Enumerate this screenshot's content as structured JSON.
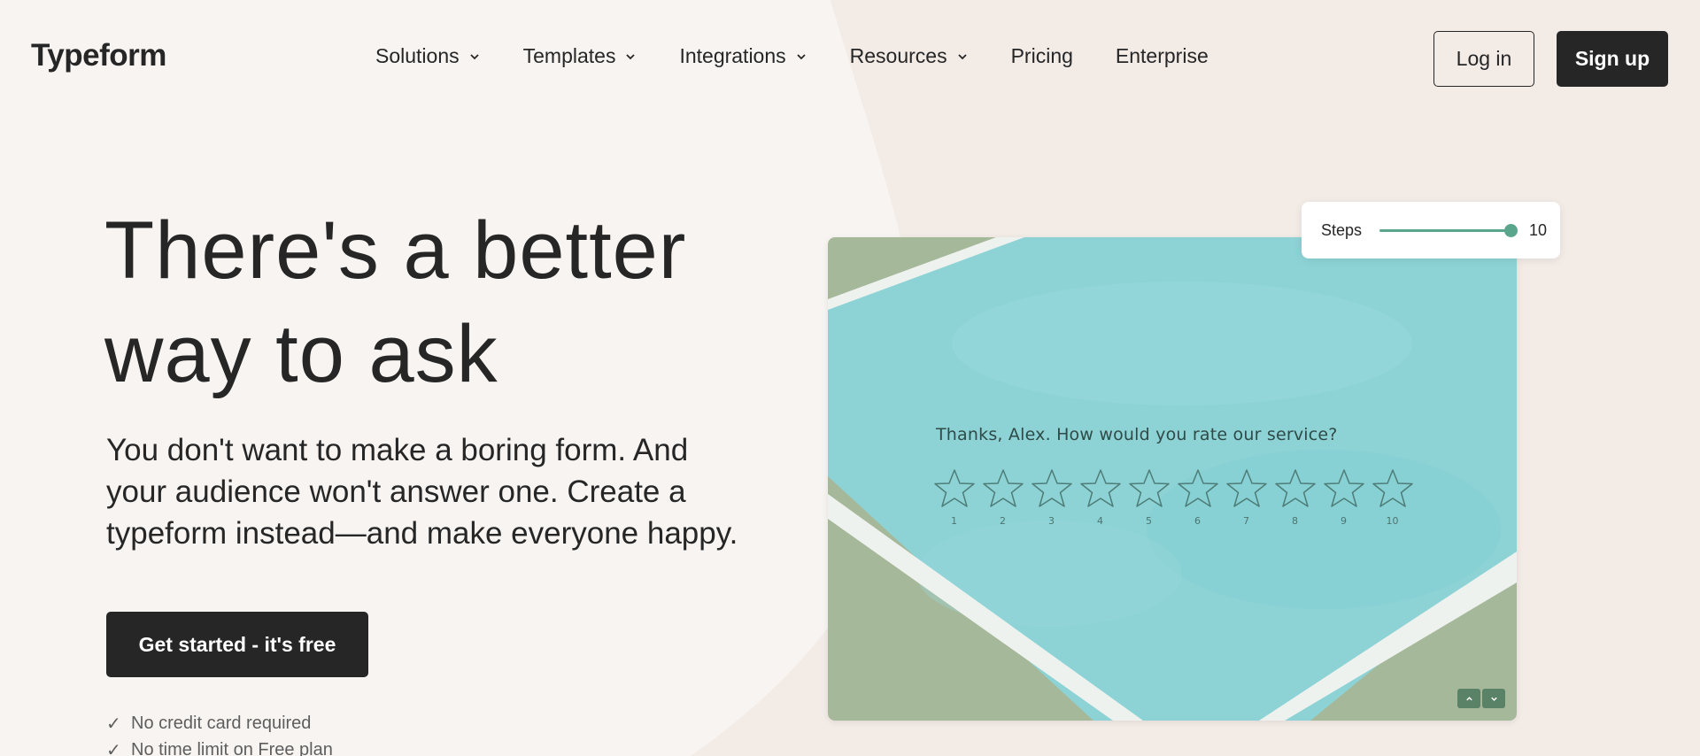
{
  "brand": {
    "logo": "Typeform"
  },
  "nav": {
    "items": [
      {
        "label": "Solutions",
        "dropdown": true
      },
      {
        "label": "Templates",
        "dropdown": true
      },
      {
        "label": "Integrations",
        "dropdown": true
      },
      {
        "label": "Resources",
        "dropdown": true
      },
      {
        "label": "Pricing",
        "dropdown": false
      },
      {
        "label": "Enterprise",
        "dropdown": false
      }
    ],
    "login_label": "Log in",
    "signup_label": "Sign up"
  },
  "hero": {
    "title_line1": "There's a better",
    "title_line2": "way to ask",
    "subtitle": "You don't want to make a boring form. And your audience won't answer one. Create a typeform instead—and make everyone happy.",
    "cta_label": "Get started - it's free",
    "checks": [
      "No credit card required",
      "No time limit on Free plan"
    ]
  },
  "demo": {
    "question": "Thanks, Alex. How would you rate our service?",
    "rating_labels": [
      "1",
      "2",
      "3",
      "4",
      "5",
      "6",
      "7",
      "8",
      "9",
      "10"
    ],
    "steps_label": "Steps",
    "steps_value": "10",
    "steps_level": 1.0
  },
  "colors": {
    "background": "#f7f4f1",
    "background_shape": "#f2ebe6",
    "dark": "#262627",
    "accent_green": "#5aa68c",
    "card_teal": "#8dd3d6",
    "card_sage": "#a6b89a"
  },
  "icons": {
    "dropdown": "chevron-down-icon",
    "check": "check-icon",
    "rating": "star-icon",
    "card_prev": "chevron-up-icon",
    "card_next": "chevron-down-icon"
  }
}
